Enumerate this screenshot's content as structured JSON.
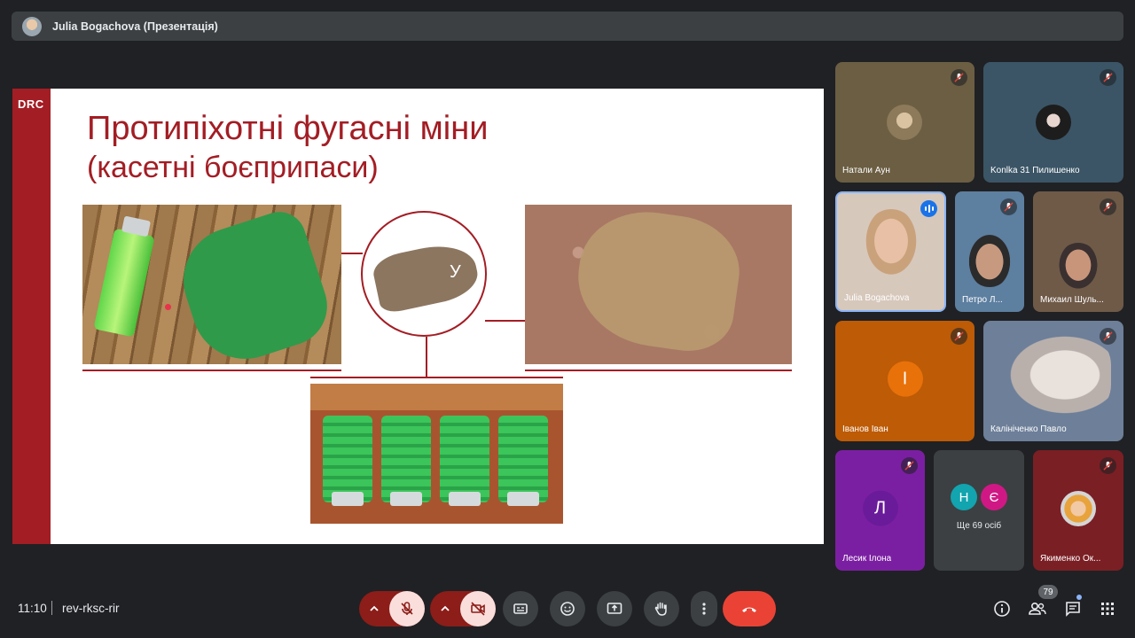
{
  "presenter_bar": {
    "title": "Julia Bogachova (Презентація)"
  },
  "slide": {
    "logo": "DRC",
    "title": "Протипіхотні фугасні міни",
    "subtitle": "(касетні боєприпаси)",
    "detail_glyph": "У"
  },
  "participants": [
    {
      "name": "Натали Аун",
      "muted": true
    },
    {
      "name": "Konlka 31 Пилишенко",
      "muted": true
    },
    {
      "name": "Julia Bogachova",
      "speaking": true
    },
    {
      "name": "Петро Л...",
      "muted": true
    },
    {
      "name": "Михаил Шуль...",
      "muted": true
    },
    {
      "name": "Іванов Іван",
      "initial": "І",
      "avatar_color": "#e8710a",
      "muted": true
    },
    {
      "name": "Калініченко Павло",
      "muted": true
    },
    {
      "name": "Лесик Ілона",
      "initial": "Л",
      "avatar_color": "#8e24aa",
      "muted": true
    },
    {
      "name": "Якименко Ок...",
      "muted": true
    }
  ],
  "more_tile": {
    "initials": [
      "Н",
      "Є"
    ],
    "colors": [
      "#12a4af",
      "#d01884"
    ],
    "label": "Ще 69 осіб"
  },
  "bottom_bar": {
    "time": "11:10",
    "meeting_code": "rev-rksc-rir",
    "people_count": "79"
  },
  "colors": {
    "accent": "#a31d24",
    "hangup": "#ea4335",
    "background": "#202124"
  }
}
